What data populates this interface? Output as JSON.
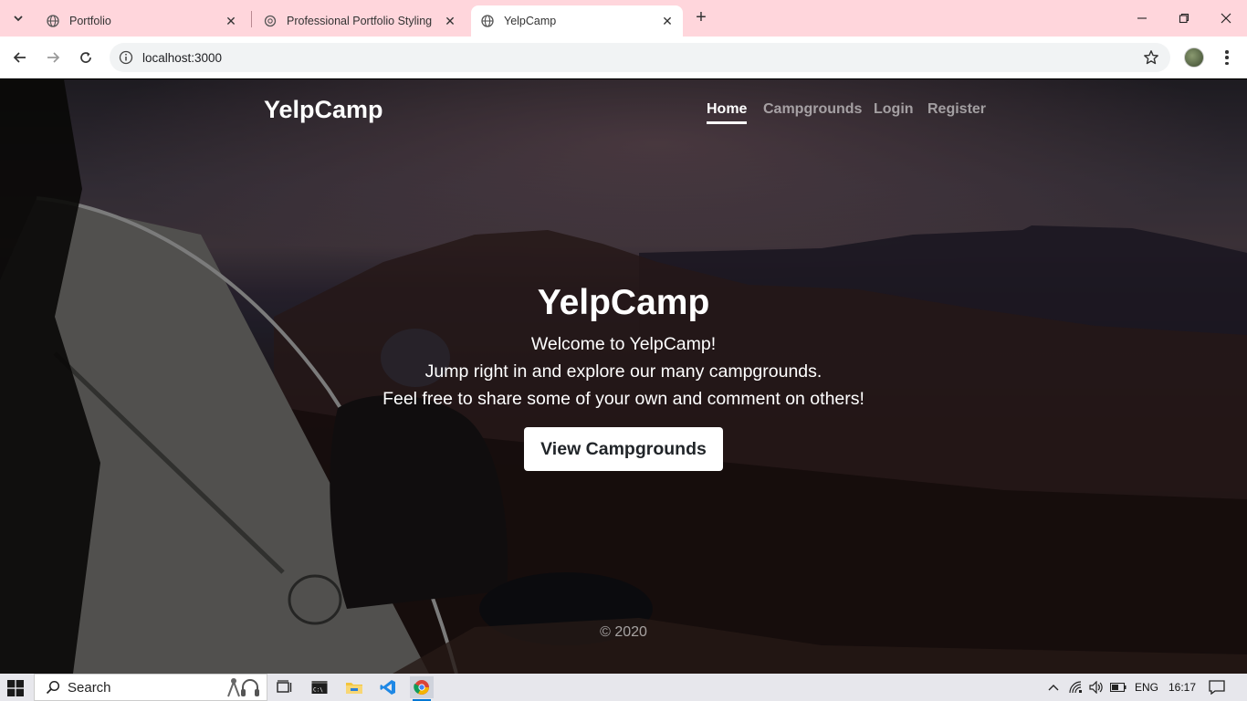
{
  "browser": {
    "tabs": [
      {
        "title": "Portfolio",
        "active": false
      },
      {
        "title": "Professional Portfolio Styling",
        "active": false
      },
      {
        "title": "YelpCamp",
        "active": true
      }
    ],
    "url": "localhost:3000"
  },
  "site": {
    "brand": "YelpCamp",
    "nav": [
      "Home",
      "Campgrounds",
      "Login",
      "Register"
    ],
    "hero": {
      "title": "YelpCamp",
      "lines": [
        "Welcome to YelpCamp!",
        "Jump right in and explore our many campgrounds.",
        "Feel free to share some of your own and comment on others!"
      ],
      "cta": "View Campgrounds"
    },
    "footer": "© 2020"
  },
  "taskbar": {
    "search_label": "Search",
    "language": "ENG",
    "time": "16:17"
  },
  "colors": {
    "tabbar_bg": "#ffd6dc",
    "taskbar_accent": "#0078d4"
  }
}
